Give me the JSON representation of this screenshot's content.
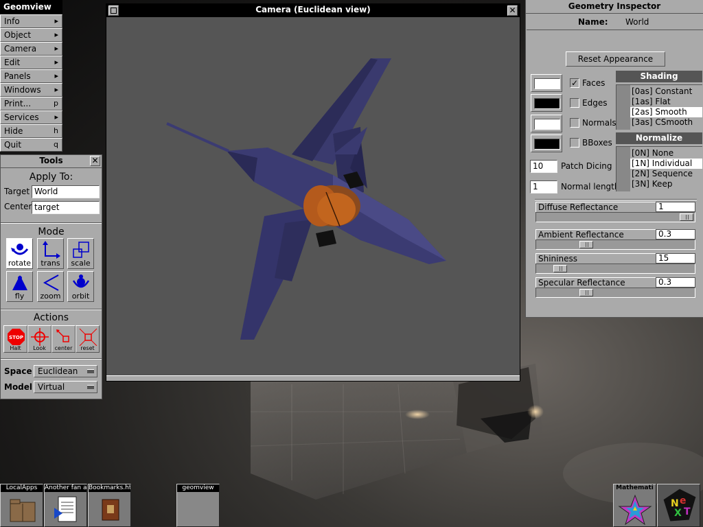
{
  "menu": {
    "title": "Geomview",
    "items": [
      {
        "label": "Info",
        "key": "▸"
      },
      {
        "label": "Object",
        "key": "▸"
      },
      {
        "label": "Camera",
        "key": "▸"
      },
      {
        "label": "Edit",
        "key": "▸"
      },
      {
        "label": "Panels",
        "key": "▸"
      },
      {
        "label": "Windows",
        "key": "▸"
      },
      {
        "label": "Print...",
        "key": "p"
      },
      {
        "label": "Services",
        "key": "▸"
      },
      {
        "label": "Hide",
        "key": "h"
      },
      {
        "label": "Quit",
        "key": "q"
      }
    ]
  },
  "tools": {
    "title": "Tools",
    "apply_to": "Apply To:",
    "target_label": "Target",
    "target_value": "World",
    "center_label": "Center",
    "center_value": "target",
    "mode_title": "Mode",
    "modes": [
      "rotate",
      "trans",
      "scale",
      "fly",
      "zoom",
      "orbit"
    ],
    "actions_title": "Actions",
    "actions": [
      "Halt",
      "Look",
      "center",
      "reset"
    ],
    "stop_text": "STOP",
    "space_label": "Space",
    "space_value": "Euclidean",
    "model_label": "Model",
    "model_value": "Virtual"
  },
  "camera": {
    "title": "Camera (Euclidean view)"
  },
  "inspector": {
    "title": "Geometry Inspector",
    "name_label": "Name:",
    "name_value": "World",
    "reset_button": "Reset Appearance",
    "checks": [
      {
        "label": "Faces",
        "checked": true
      },
      {
        "label": "Edges",
        "checked": false
      },
      {
        "label": "Normals",
        "checked": false
      },
      {
        "label": "BBoxes",
        "checked": false
      }
    ],
    "swatch_colors": [
      "#ffffff",
      "#000000",
      "#ffffff",
      "#000000"
    ],
    "patch_dicing_label": "Patch Dicing",
    "patch_dicing_value": "10",
    "normal_length_label": "Normal length",
    "normal_length_value": "1",
    "shading_title": "Shading",
    "shading_options": [
      "[0as] Constant",
      "[1as] Flat",
      "[2as] Smooth",
      "[3as] CSmooth"
    ],
    "shading_selected": "[2as] Smooth",
    "normalize_title": "Normalize",
    "normalize_options": [
      "[0N] None",
      "[1N] Individual",
      "[2N] Sequence",
      "[3N] Keep"
    ],
    "normalize_selected": "[1N] Individual",
    "sliders": [
      {
        "label": "Diffuse Reflectance",
        "value": "1",
        "fraction": 1.0
      },
      {
        "label": "Ambient Reflectance",
        "value": "0.3",
        "fraction": 0.3
      },
      {
        "label": "Shininess",
        "value": "15",
        "fraction": 0.12
      },
      {
        "label": "Specular Reflectance",
        "value": "0.3",
        "fraction": 0.3
      }
    ]
  },
  "dock": {
    "tiles": [
      "LocalApps",
      "Another fan a",
      "Bookmarks.ht",
      "geomview"
    ],
    "right_tiles": [
      "Mathemati"
    ]
  },
  "colors": {
    "accent_active": "#000000",
    "panel": "#aaaaaa",
    "aircraft": "#3c3a6e",
    "engine": "#b85a18"
  }
}
